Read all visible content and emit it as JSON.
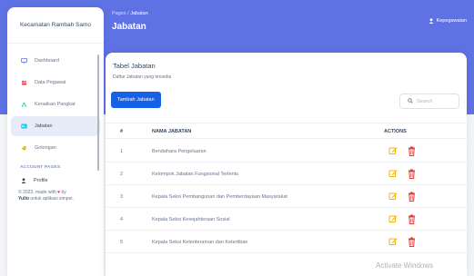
{
  "app": {
    "brand": "Kecamatan Rambah Samo"
  },
  "sidebar": {
    "items": [
      {
        "label": "Dashboard"
      },
      {
        "label": "Data Pegawai"
      },
      {
        "label": "Kenaikan Pangkat"
      },
      {
        "label": "Jabatan"
      },
      {
        "label": "Golongan"
      }
    ],
    "section_title": "ACCOUNT PAGES",
    "profile": "Profile",
    "footer": {
      "line1": "© 2023, made with",
      "line1_end": "by",
      "author": "Yulio",
      "line2_end": "untuk aplikasi simpei."
    }
  },
  "header": {
    "breadcrumb_root": "Pages",
    "breadcrumb_sep": "/",
    "breadcrumb_current": "Jabatan",
    "title": "Jabatan",
    "user": "Kepegawaian"
  },
  "card": {
    "title": "Tabel Jabatan",
    "subtitle": "Daftar Jabatan yang tersedia",
    "add_button": "Tambah Jabatan",
    "search_placeholder": "Search"
  },
  "table": {
    "columns": [
      "#",
      "NAMA JABATAN",
      "ACTIONS"
    ],
    "rows": [
      {
        "no": "1",
        "name": "Bendahara Pengeluaran"
      },
      {
        "no": "2",
        "name": "Kelompok Jabatan Fungsional Tertentu"
      },
      {
        "no": "3",
        "name": "Kepala Seksi Pembangunan dan Pemberdayaan Masyarakat"
      },
      {
        "no": "4",
        "name": "Kepala Seksi Kesejahteraan Sosial"
      },
      {
        "no": "5",
        "name": "Kepala Seksi Ketenteraman dan Ketertiban"
      }
    ]
  },
  "watermark": "Activate Windows",
  "colors": {
    "primary": "#5e72e4",
    "button": "#1761e6",
    "edit": "#f5b400",
    "delete": "#e53935"
  }
}
